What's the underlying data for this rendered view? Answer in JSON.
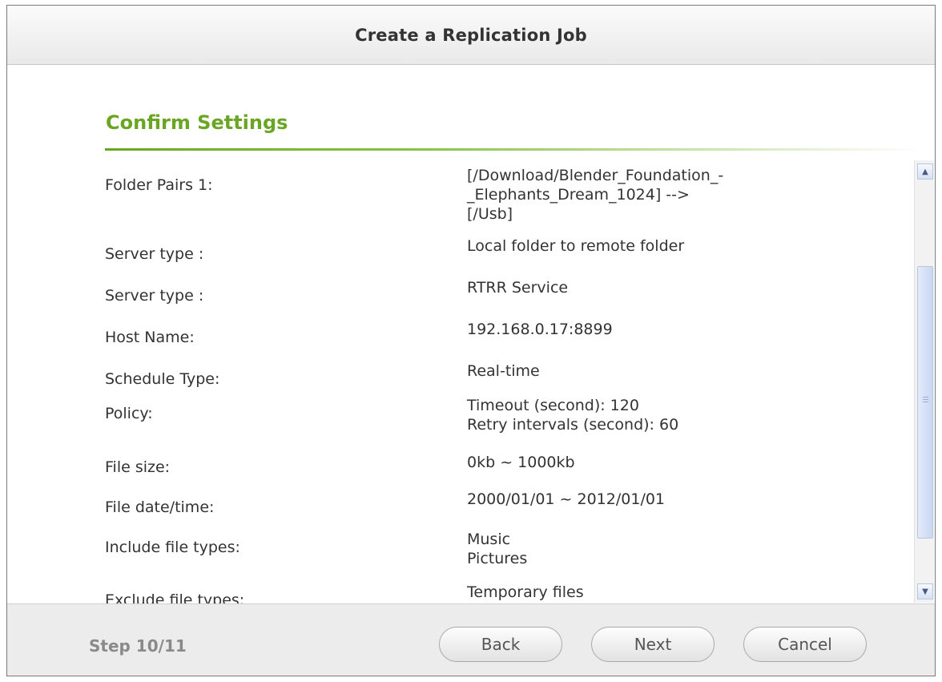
{
  "dialog": {
    "title": "Create a Replication Job",
    "section_title": "Confirm Settings"
  },
  "settings": [
    {
      "label": "Folder Pairs 1:",
      "lines": [
        "[/Download/Blender_Foundation_-",
        "_Elephants_Dream_1024] -->",
        "[/Usb]"
      ]
    },
    {
      "label": "Server type :",
      "lines": [
        "Local folder to remote folder"
      ]
    },
    {
      "label": "Server type :",
      "lines": [
        "RTRR Service"
      ]
    },
    {
      "label": "Host Name:",
      "lines": [
        "192.168.0.17:8899"
      ]
    },
    {
      "label": "Schedule Type:",
      "lines": [
        "Real-time"
      ]
    },
    {
      "label": "Policy:",
      "lines": [
        "Timeout (second): 120",
        "Retry intervals (second): 60"
      ]
    },
    {
      "label": "File size:",
      "lines": [
        "0kb ~ 1000kb"
      ]
    },
    {
      "label": "File date/time:",
      "lines": [
        "2000/01/01 ~ 2012/01/01"
      ]
    },
    {
      "label": "Include file types:",
      "lines": [
        "Music",
        "Pictures"
      ]
    },
    {
      "label": "Exclude file types:",
      "lines": [
        "Temporary files"
      ]
    }
  ],
  "scrollbar": {
    "up_icon": "chevron-up-icon",
    "down_icon": "chevron-down-icon"
  },
  "footer": {
    "step": "Step 10/11",
    "back_label": "Back",
    "next_label": "Next",
    "cancel_label": "Cancel"
  },
  "colors": {
    "section_title": "#6aa624",
    "footer_bg": "#ececec"
  }
}
